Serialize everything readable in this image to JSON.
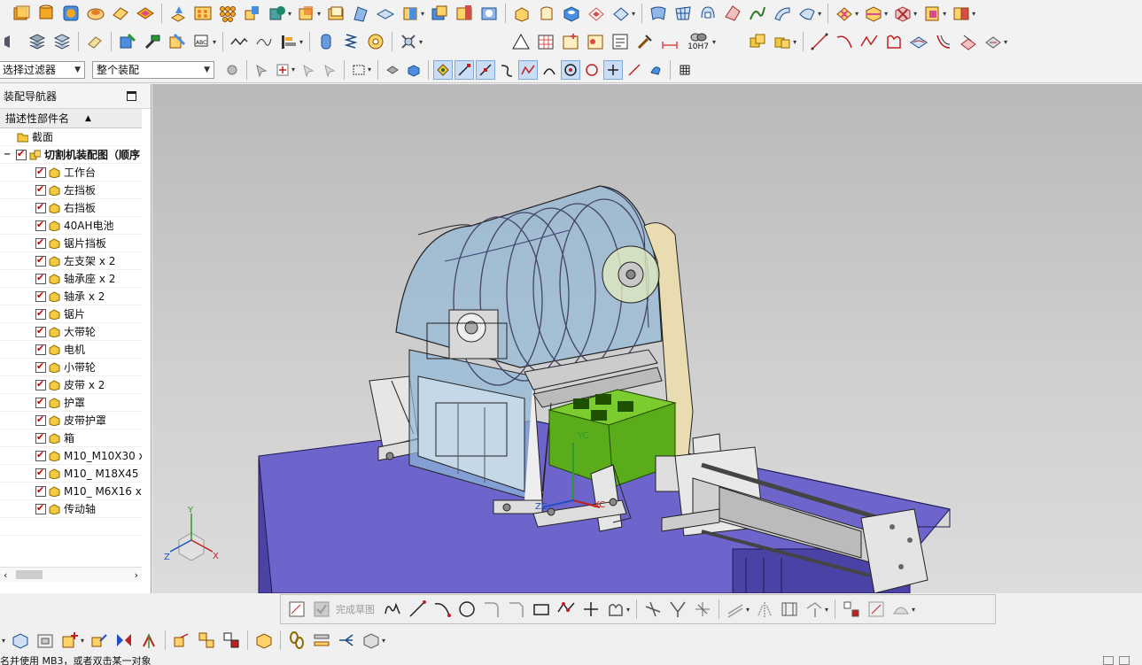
{
  "navigator": {
    "title": "装配导航器",
    "column_header": "描述性部件名",
    "section_folder": "截面",
    "root_assembly": "切割机装配图（顺序",
    "parts": [
      "工作台",
      "左挡板",
      "右挡板",
      "40AH电池",
      "锯片挡板",
      "左支架 x 2",
      "轴承座 x 2",
      "轴承 x 2",
      "锯片",
      "大带轮",
      "电机",
      "小带轮",
      "皮带 x 2",
      "护罩",
      "皮带护罩",
      "箱",
      "M10_M10X30 x",
      "M10_ M18X45",
      "M10_ M6X16 x",
      "传动轴"
    ]
  },
  "selection_bar": {
    "filter_value": "选择过滤器",
    "scope_value": "整个装配"
  },
  "toolbar": {
    "fit_label": "10H7"
  },
  "sketch_toolbar": {
    "finish_label": "完成草图"
  },
  "status_bar": {
    "message": "名并使用 MB3，或者双击某一对象"
  },
  "viewport": {
    "triad_labels": {
      "x": "X",
      "y": "Y",
      "z": "Z"
    },
    "wcs_labels": {
      "xc": "XC",
      "zc": "ZC",
      "yc": "YC"
    }
  },
  "colors": {
    "base_blue": "#5a52b8",
    "base_top": "#6d65cc",
    "battery_green": "#5aac1a",
    "guard_blue": "#8fb8d8",
    "belt_guard": "#e8dcb0"
  }
}
